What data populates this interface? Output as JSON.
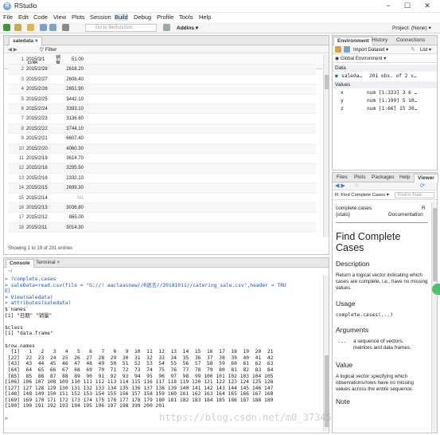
{
  "window": {
    "title": "RStudio",
    "minimize": "−",
    "maximize": "☐",
    "close": "✕"
  },
  "menu": [
    "File",
    "Edit",
    "Code",
    "View",
    "Plots",
    "Session",
    "Build",
    "Debug",
    "Profile",
    "Tools",
    "Help"
  ],
  "toolbar": {
    "goto_placeholder": "Go to file/function",
    "addins": "Addins ▾",
    "project": "Project: (None) ▾"
  },
  "source": {
    "tab": "saledata",
    "filter": "Filter",
    "col_date": "日期",
    "col_sales": "销量",
    "rows": [
      [
        "1",
        "2015/3/1",
        "51.00"
      ],
      [
        "2",
        "2015/2/28",
        "2618.20"
      ],
      [
        "3",
        "2015/2/27",
        "2608.40"
      ],
      [
        "4",
        "2015/2/26",
        "2651.90"
      ],
      [
        "5",
        "2015/2/25",
        "3442.10"
      ],
      [
        "6",
        "2015/2/24",
        "3393.10"
      ],
      [
        "7",
        "2015/2/23",
        "3136.60"
      ],
      [
        "8",
        "2015/2/22",
        "3744.10"
      ],
      [
        "9",
        "2015/2/21",
        "6607.40"
      ],
      [
        "10",
        "2015/2/20",
        "4060.30"
      ],
      [
        "11",
        "2015/2/19",
        "3614.70"
      ],
      [
        "12",
        "2015/2/18",
        "3295.50"
      ],
      [
        "13",
        "2015/2/16",
        "2332.10"
      ],
      [
        "14",
        "2015/2/15",
        "2699.30"
      ],
      [
        "15",
        "2015/2/14",
        "NA"
      ],
      [
        "16",
        "2015/2/13",
        "3036.80"
      ],
      [
        "17",
        "2015/2/12",
        "865.00"
      ],
      [
        "18",
        "2015/2/11",
        "3014.30"
      ]
    ],
    "footer": "Showing 1 to 19 of 201 entries"
  },
  "console": {
    "tabs": [
      "Console",
      "Terminal ×"
    ],
    "path": "~/",
    "lines": [
      {
        "t": "> ?complete.cases",
        "c": "blue"
      },
      {
        "t": "> saleData=read.csv(file = \"G://! aaclassnew//R语言//20181011//catering_sale.csv\",header = TRU",
        "c": "blue"
      },
      {
        "t": "E)",
        "c": "blue"
      },
      {
        "t": "> View(saledata)",
        "c": "blue"
      },
      {
        "t": "> attributes(saledata)",
        "c": "blue"
      },
      {
        "t": "$`names`",
        "c": ""
      },
      {
        "t": "[1] \"日期\" \"销量\"",
        "c": ""
      },
      {
        "t": "",
        "c": ""
      },
      {
        "t": "$class",
        "c": ""
      },
      {
        "t": "[1] \"data.frame\"",
        "c": ""
      },
      {
        "t": "",
        "c": ""
      },
      {
        "t": "$row.names",
        "c": ""
      },
      {
        "t": "  [1]   1   2   3   4   5   6   7   8   9  10  11  12  13  14  15  16  17  18  19  20  21",
        "c": ""
      },
      {
        "t": " [22]  22  23  24  25  26  27  28  29  30  31  32  33  34  35  36  37  38  39  40  41  42",
        "c": ""
      },
      {
        "t": " [43]  43  44  45  46  47  48  49  50  51  52  53  54  55  56  57  58  59  60  61  62  63",
        "c": ""
      },
      {
        "t": " [64]  64  65  66  67  68  69  70  71  72  73  74  75  76  77  78  79  80  81  82  83  84",
        "c": ""
      },
      {
        "t": " [85]  85  86  87  88  89  90  91  92  93  94  95  96  97  98  99 100 101 102 103 104 105",
        "c": ""
      },
      {
        "t": "[106] 106 107 108 109 110 111 112 113 114 115 116 117 118 119 120 121 122 123 124 125 126",
        "c": ""
      },
      {
        "t": "[127] 127 128 129 130 131 132 133 134 135 136 137 138 139 140 141 142 143 144 145 146 147",
        "c": ""
      },
      {
        "t": "[148] 148 149 150 151 152 153 154 155 156 157 158 159 160 161 162 163 164 165 166 167 168",
        "c": ""
      },
      {
        "t": "[169] 169 170 171 172 173 174 175 176 177 178 179 180 181 182 183 184 185 186 187 188 189",
        "c": ""
      },
      {
        "t": "[190] 190 191 192 193 194 195 196 197 198 199 200 201",
        "c": ""
      },
      {
        "t": "",
        "c": ""
      },
      {
        "t": ">",
        "c": "blue"
      }
    ],
    "watermark": "https://blog.csdn.net/m0_37345402"
  },
  "env": {
    "tabs": [
      "Environment",
      "History",
      "Connections"
    ],
    "import": "Import Dataset ▾",
    "list": "List ▾",
    "global": "Global Environment ▾",
    "data_header": "Data",
    "data_row": {
      "name": "saleda…",
      "desc": "201 obs. of 2 v…"
    },
    "values_header": "Values",
    "values": [
      {
        "name": "x",
        "val": "num [1:333] 3 6 …"
      },
      {
        "name": "y",
        "val": "num [1:199] 5 10…"
      },
      {
        "name": "z",
        "val": "num [1:66] 15 30…"
      }
    ]
  },
  "help": {
    "tabs": [
      "Files",
      "Plots",
      "Packages",
      "Help",
      "Viewer"
    ],
    "crumb": "R: Find Complete Cases ▾",
    "find_placeholder": "Find in Topic",
    "fn": "complete.cases",
    "pkg": "{stats}",
    "r": "R",
    "doc": "Documentation",
    "title": "Find Complete Cases",
    "desc_h": "Description",
    "desc": "Return a logical vector indicating which cases are complete, i.e., have no missing values.",
    "usage_h": "Usage",
    "usage": "complete.cases(...)",
    "args_h": "Arguments",
    "arg_name": "...",
    "arg_desc": "a sequence of vectors, matrices and data frames.",
    "value_h": "Value",
    "value": "A logical vector specifying which observations/rows have no missing values across the entire sequence.",
    "note_h": "Note"
  }
}
